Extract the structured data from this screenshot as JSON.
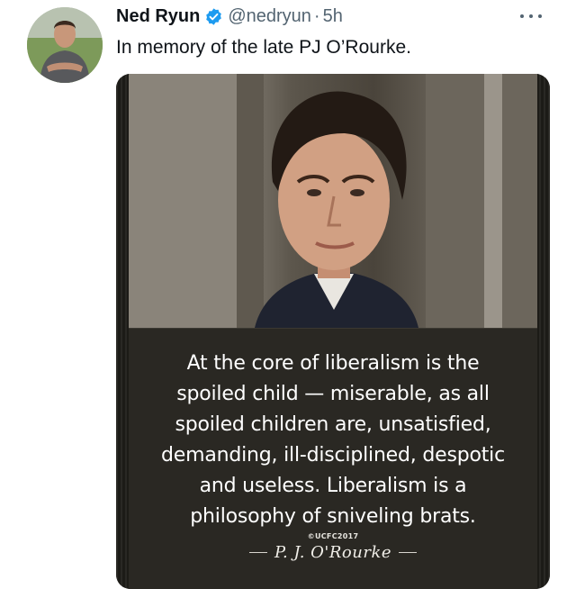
{
  "tweet": {
    "author_name": "Ned Ryun",
    "handle": "@nedryun",
    "separator": "·",
    "time": "5h",
    "text": "In memory of the late PJ O’Rourke.",
    "verified_icon": "verified-badge-icon",
    "more_icon": "more-options-icon"
  },
  "media": {
    "quote_lines": [
      "At the core of liberalism is the",
      "spoiled child — miserable, as all",
      "spoiled children are, unsatisfied,",
      "demanding, ill-disciplined, despotic",
      "and useless. Liberalism is a",
      "philosophy of sniveling brats."
    ],
    "copyright": "©UCFC2017",
    "signature": "P. J. O'Rourke"
  },
  "colors": {
    "text_primary": "#0f1419",
    "text_secondary": "#536471",
    "verified_blue": "#1d9bf0",
    "background": "#ffffff"
  }
}
